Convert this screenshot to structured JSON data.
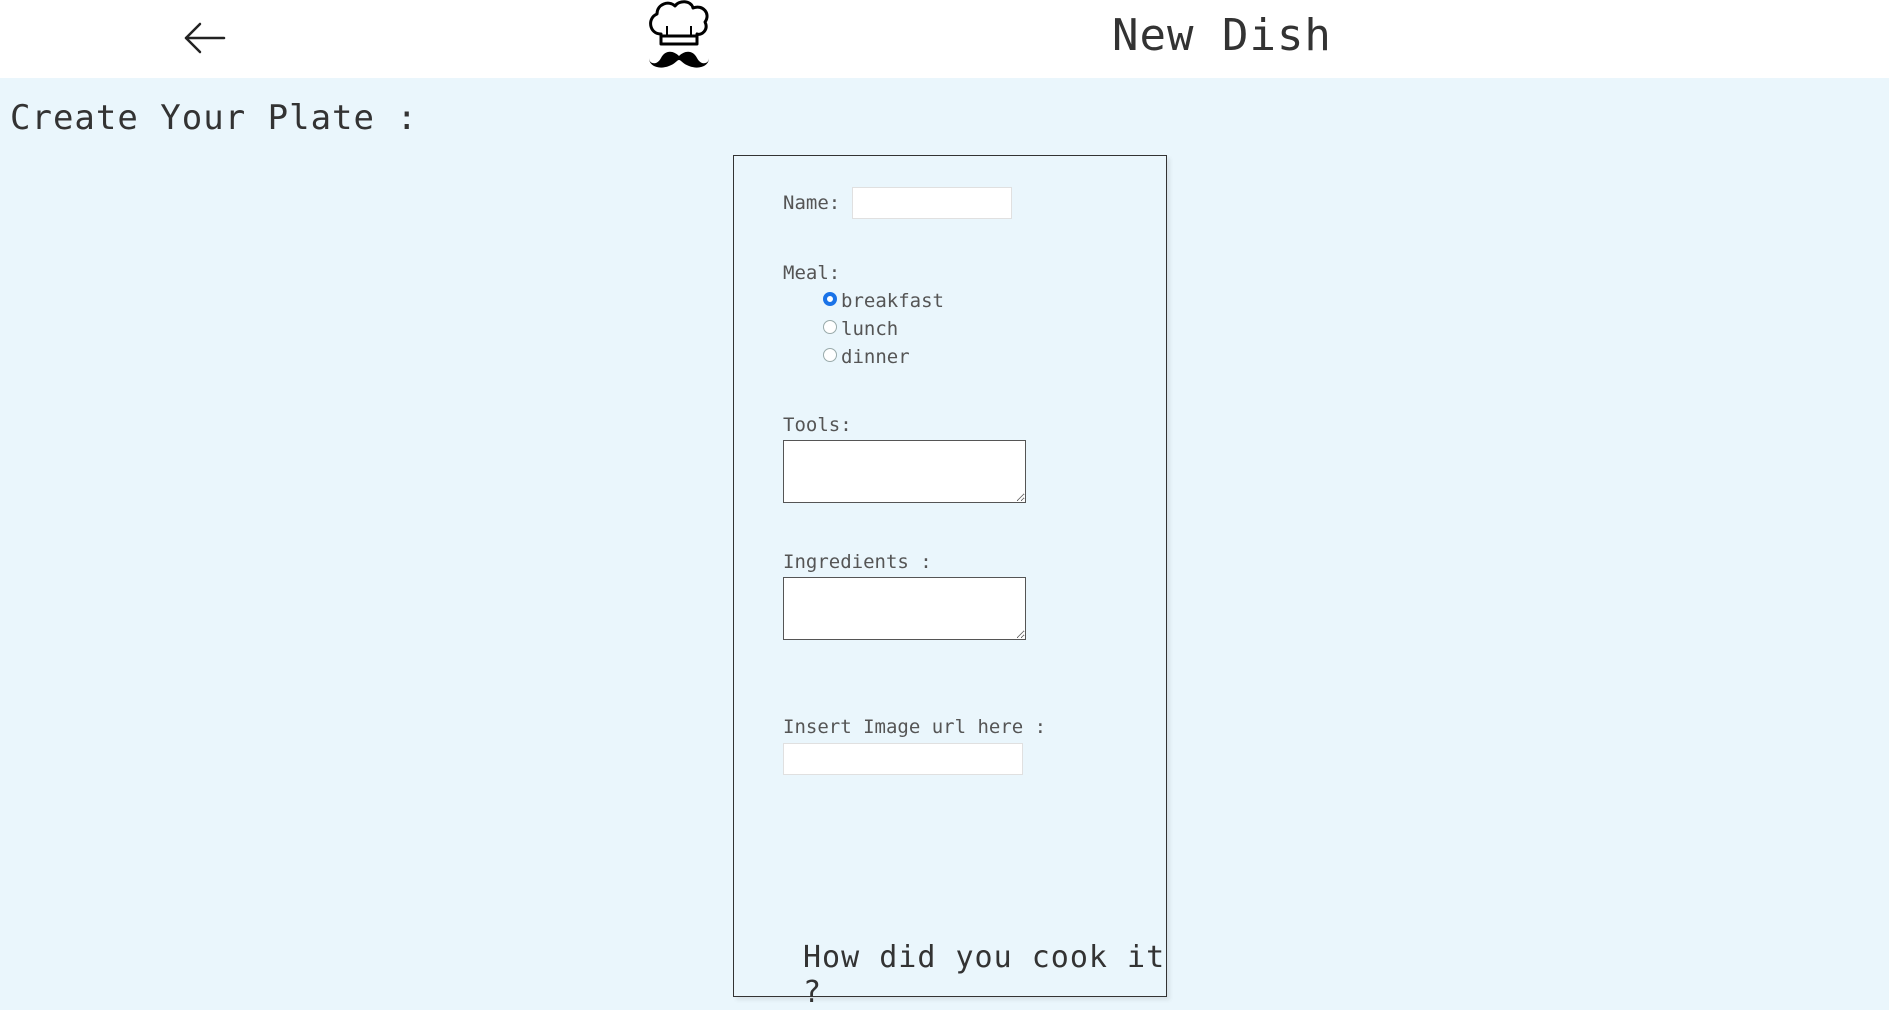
{
  "header": {
    "back_icon": "arrow-left-icon",
    "logo_icon": "chef-hat-mustache-icon",
    "title": "New Dish"
  },
  "page": {
    "heading": "Create Your Plate :"
  },
  "form": {
    "name_label": "Name:",
    "name_value": "",
    "meal_label": "Meal:",
    "meal_options": [
      {
        "label": "breakfast",
        "checked": true
      },
      {
        "label": "lunch",
        "checked": false
      },
      {
        "label": "dinner",
        "checked": false
      }
    ],
    "tools_label": "Tools:",
    "tools_value": "",
    "ingredients_label": "Ingredients :",
    "ingredients_value": "",
    "image_url_label": "Insert Image url here :",
    "image_url_value": "",
    "cook_heading": "How did you cook it ?"
  },
  "colors": {
    "background": "#eaf6fc",
    "header_background": "#ffffff",
    "radio_accent": "#1a73e8"
  }
}
